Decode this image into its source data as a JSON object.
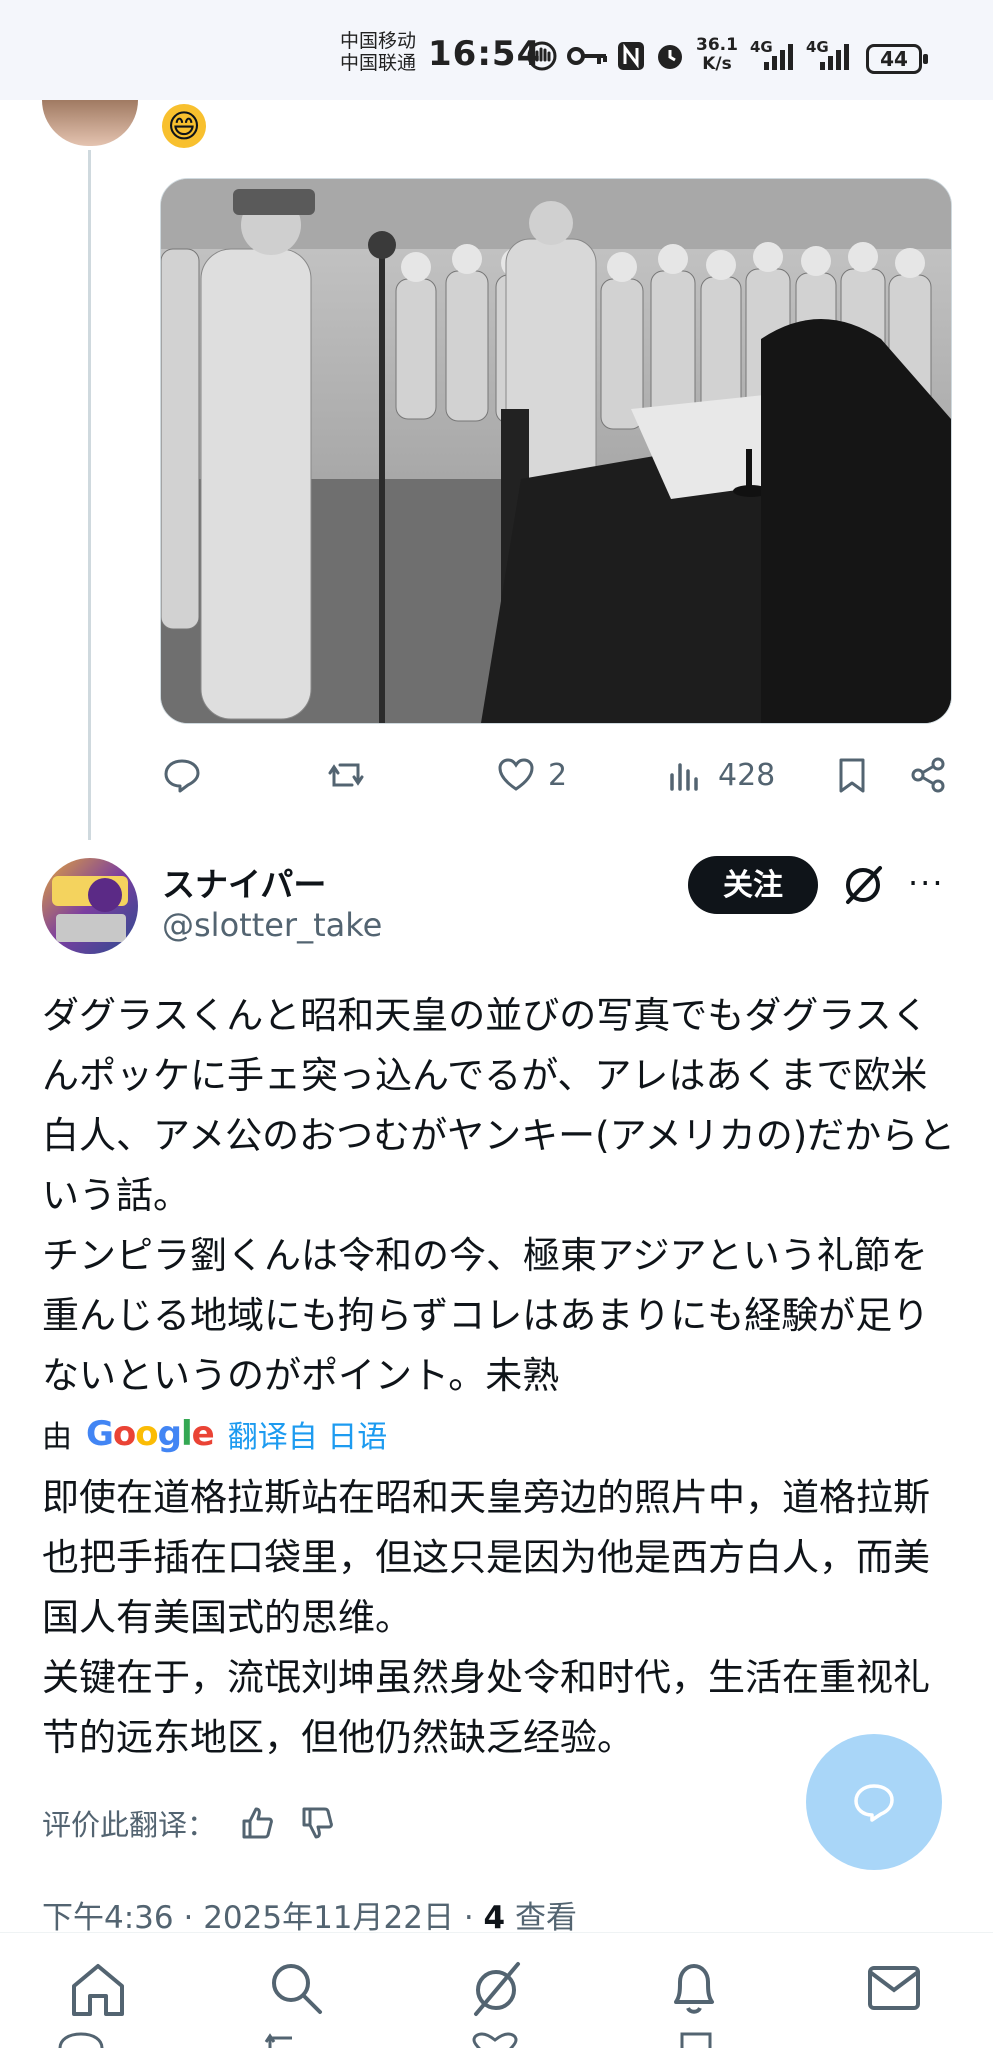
{
  "status_bar": {
    "carrier_1": "中国移动",
    "carrier_2": "中国联通",
    "time": "16:54",
    "speed_value": "36.1",
    "speed_unit": "K/s",
    "network_1": "4G",
    "network_2": "4G",
    "battery": "44"
  },
  "previous_post": {
    "emoji": "😄",
    "photo_description": "black-and-white photograph",
    "actions": {
      "likes": "2",
      "views": "428"
    }
  },
  "post": {
    "display_name": "スナイパー",
    "handle": "@slotter_take",
    "follow_label": "关注",
    "more_label": "···",
    "original_paragraph_1": "ダグラスくんと昭和天皇の並びの写真でもダグラスくんポッケに手ェ突っ込んでるが、アレはあくまで欧米白人、アメ公のおつむがヤンキー(アメリカの)だからという話。",
    "original_paragraph_2": "チンピラ劉くんは令和の今、極東アジアという礼節を重んじる地域にも拘らずコレはあまりにも経験が足りないというのがポイント。未熟",
    "translation_by": "由",
    "google_label": "Google",
    "translated_from": "翻译自 日语",
    "translated_paragraph_1": "即使在道格拉斯站在昭和天皇旁边的照片中，道格拉斯也把手插在口袋里，但这只是因为他是西方白人，而美国人有美国式的思维。",
    "translated_paragraph_2": "关键在于，流氓刘坤虽然身处令和时代，生活在重视礼节的远东地区，但他仍然缺乏经验。",
    "rate_translation_label": "评价此翻译：",
    "time": "下午4:36",
    "date": "2025年11月22日",
    "views_count": "4",
    "views_label": "查看"
  },
  "colors": {
    "accent": "#1d9bf0",
    "secondary_text": "#536471",
    "fab": "#a9d6f8"
  }
}
